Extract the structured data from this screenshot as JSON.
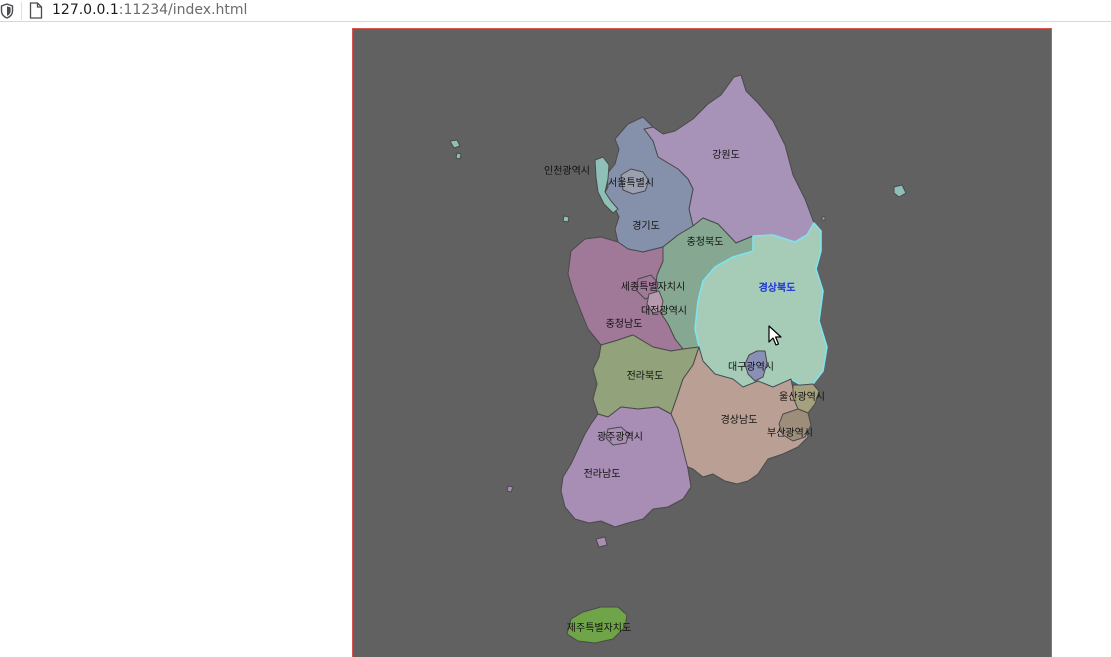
{
  "browser": {
    "url_host": "127.0.0.1",
    "url_rest": ":11234/index.html"
  },
  "map": {
    "hovered_region": "gyeongbuk",
    "regions": [
      {
        "id": "gangwon",
        "label": "강원도",
        "color": "#a893b8"
      },
      {
        "id": "incheon",
        "label": "인천광역시",
        "color": "#8fc0b8"
      },
      {
        "id": "seoul",
        "label": "서울특별시",
        "color": "#9aa0b0"
      },
      {
        "id": "gyeonggi",
        "label": "경기도",
        "color": "#8590aa"
      },
      {
        "id": "chungbuk",
        "label": "충청북도",
        "color": "#86a892"
      },
      {
        "id": "sejong",
        "label": "세종특별자치시",
        "color": "#a07898"
      },
      {
        "id": "daejeon",
        "label": "대전광역시",
        "color": "#b89ab0"
      },
      {
        "id": "chungnam",
        "label": "충청남도",
        "color": "#a07898"
      },
      {
        "id": "gyeongbuk",
        "label": "경상북도",
        "color": "#a6cbb7"
      },
      {
        "id": "daegu",
        "label": "대구광역시",
        "color": "#8a8fb8"
      },
      {
        "id": "ulsan",
        "label": "울산광역시",
        "color": "#a5a07e"
      },
      {
        "id": "jeonbuk",
        "label": "전라북도",
        "color": "#92a27a"
      },
      {
        "id": "gyeongnam",
        "label": "경상남도",
        "color": "#baa094"
      },
      {
        "id": "busan",
        "label": "부산광역시",
        "color": "#9c8e7a"
      },
      {
        "id": "gwangju",
        "label": "광주광역시",
        "color": "#a88db4"
      },
      {
        "id": "jeonnam",
        "label": "전라남도",
        "color": "#a88db4"
      },
      {
        "id": "jeju",
        "label": "제주특별자치도",
        "color": "#6fa548"
      }
    ]
  }
}
